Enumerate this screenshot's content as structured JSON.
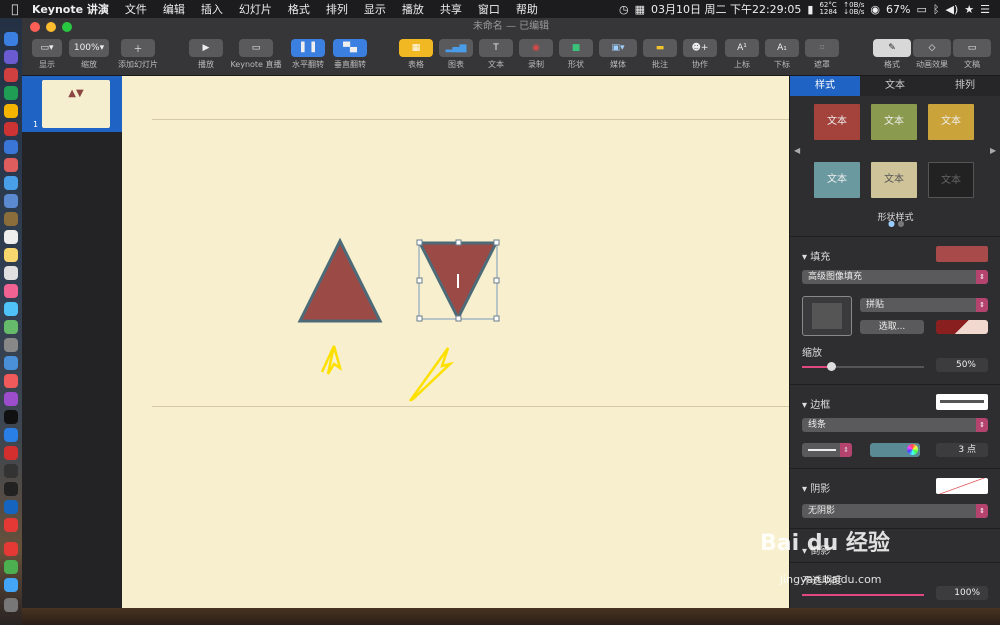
{
  "menubar": {
    "app_name": "Keynote 讲演",
    "items": [
      "文件",
      "编辑",
      "插入",
      "幻灯片",
      "格式",
      "排列",
      "显示",
      "播放",
      "共享",
      "窗口",
      "帮助"
    ],
    "datetime": "03月10日 周二 下午22:29:05",
    "temp_top": "62°C",
    "temp_bottom": "1284",
    "net_top": "↑0B/s",
    "net_bottom": "↓0B/s",
    "battery": "67%"
  },
  "window": {
    "title": "未命名",
    "subtitle": "— 已编辑"
  },
  "toolbar": {
    "view_label": "显示",
    "zoom_value": "100%",
    "zoom_label": "缩放",
    "add_slide_label": "添加幻灯片",
    "play_label": "播放",
    "live_label": "Keynote 直播",
    "flip_h_label": "水平翻转",
    "flip_v_label": "垂直翻转",
    "table_label": "表格",
    "chart_label": "图表",
    "text_label": "文本",
    "record_label": "录制",
    "shape_label": "形状",
    "media_label": "媒体",
    "comment_label": "批注",
    "collab_label": "协作",
    "superscript_label": "上标",
    "subscript_label": "下标",
    "mask_label": "遮罩",
    "format_label": "格式",
    "animate_label": "动画效果",
    "document_label": "文稿"
  },
  "navigator": {
    "slide_number": "1",
    "thumb_text": "▲▼"
  },
  "inspector": {
    "tabs": [
      "样式",
      "文本",
      "排列"
    ],
    "swatches": [
      "文本",
      "文本",
      "文本",
      "文本",
      "文本",
      "文本"
    ],
    "shape_styles_label": "形状样式",
    "fill_label": "填充",
    "fill_type": "高级图像填充",
    "tile_option": "拼贴",
    "choose_button": "选取...",
    "scale_label": "缩放",
    "scale_value": "50%",
    "border_label": "边框",
    "border_type": "线条",
    "border_width": "3 点",
    "shadow_label": "阴影",
    "shadow_type": "无阴影",
    "reflection_label": "倒影",
    "opacity_label": "不透明度",
    "opacity_value": "100%"
  },
  "colors": {
    "triangle_fill": "#9b4a46",
    "triangle_stroke": "#4d6a78",
    "slide_bg": "#f7efcd",
    "accent_blue": "#1f63c4",
    "arrow_yellow": "#fde000"
  },
  "watermark": {
    "brand": "Bai du 经验",
    "url": "jingyan.baidu.com"
  }
}
